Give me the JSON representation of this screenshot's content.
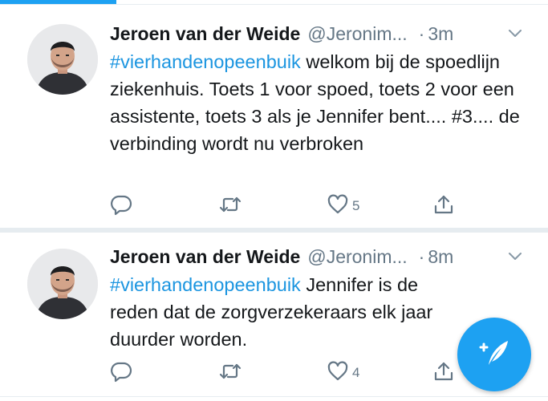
{
  "tweets": [
    {
      "author_name": "Jeroen van der Weide",
      "handle": "@Jeronim...",
      "dot": "·",
      "time": "3m",
      "hashtag": "#vierhandenopeenbuik",
      "text": " welkom bij de spoedlijn ziekenhuis. Toets 1 voor spoed, toets 2 voor een assistente, toets 3 als je Jennifer bent.... #3.... de verbinding wordt nu verbroken",
      "like_count": "5",
      "icons": {
        "avatar": "avatar-photo",
        "menu": "chevron-down-icon",
        "reply": "reply-icon",
        "retweet": "retweet-icon",
        "like": "heart-icon",
        "share": "share-icon"
      }
    },
    {
      "author_name": "Jeroen van der Weide",
      "handle": "@Jeronim...",
      "dot": "·",
      "time": "8m",
      "hashtag": "#vierhandenopeenbuik",
      "text": " Jennifer is de reden dat de zorgverzekeraars elk jaar duurder worden.",
      "like_count": "4",
      "icons": {
        "avatar": "avatar-photo",
        "menu": "chevron-down-icon",
        "reply": "reply-icon",
        "retweet": "retweet-icon",
        "like": "heart-icon",
        "share": "share-icon"
      }
    }
  ],
  "fab": {
    "icon": "compose-tweet-icon"
  },
  "colors": {
    "accent": "#1da1f2",
    "hashtag": "#1b95e0",
    "muted": "#657786",
    "text": "#14171a",
    "divider": "#e6ecf0"
  }
}
